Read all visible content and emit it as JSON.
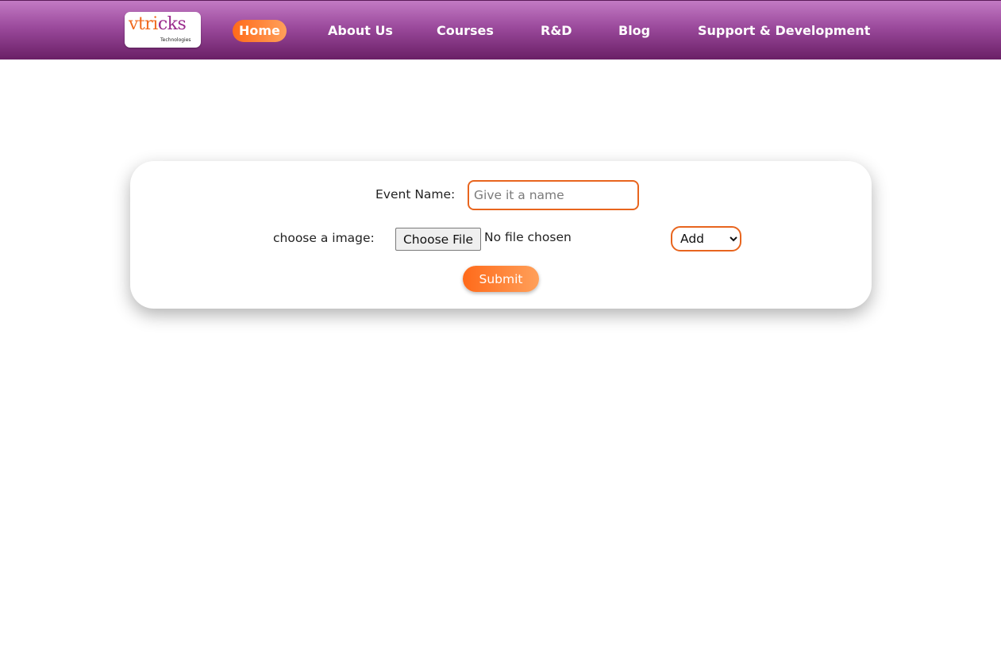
{
  "nav": {
    "logo": {
      "main_part1": "vtri",
      "main_part2": "cks",
      "sub": "Technologies"
    },
    "items": [
      {
        "label": "Home",
        "active": true
      },
      {
        "label": "About Us",
        "active": false
      },
      {
        "label": "Courses",
        "active": false
      },
      {
        "label": "R&D",
        "active": false
      },
      {
        "label": "Blog",
        "active": false
      },
      {
        "label": "Support & Development",
        "active": false
      }
    ]
  },
  "form": {
    "event_name_label": "Event Name:",
    "event_name_placeholder": "Give it a name",
    "event_name_value": "",
    "image_label": "choose a image:",
    "file_button_label": "Choose File",
    "file_status": "No file chosen",
    "select_value": "Add",
    "submit_label": "Submit"
  },
  "colors": {
    "nav_gradient_top": "#c27ac4",
    "nav_gradient_bottom": "#6a1f66",
    "accent_orange": "#ff6a1a",
    "accent_orange_light": "#ffa05a",
    "input_border": "#e8651e"
  }
}
